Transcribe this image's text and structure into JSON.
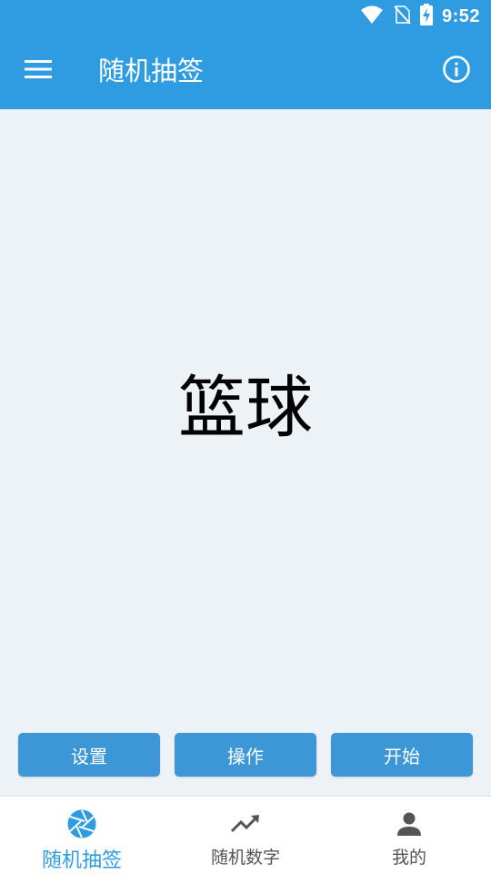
{
  "status_bar": {
    "time": "9:52",
    "icons": [
      "wifi-icon",
      "no-sim-icon",
      "battery-charging-icon"
    ]
  },
  "app_bar": {
    "title": "随机抽签",
    "menu_icon": "hamburger-menu-icon",
    "info_icon": "info-icon"
  },
  "main": {
    "result": "篮球"
  },
  "actions": {
    "settings_label": "设置",
    "operate_label": "操作",
    "start_label": "开始"
  },
  "bottom_nav": {
    "items": [
      {
        "label": "随机抽签",
        "icon": "aperture-icon",
        "active": true
      },
      {
        "label": "随机数字",
        "icon": "trending-up-icon",
        "active": false
      },
      {
        "label": "我的",
        "icon": "person-icon",
        "active": false
      }
    ]
  },
  "colors": {
    "primary": "#2f9be0",
    "button": "#3d96d6",
    "background": "#edf2f7",
    "nav_inactive": "#555555"
  }
}
